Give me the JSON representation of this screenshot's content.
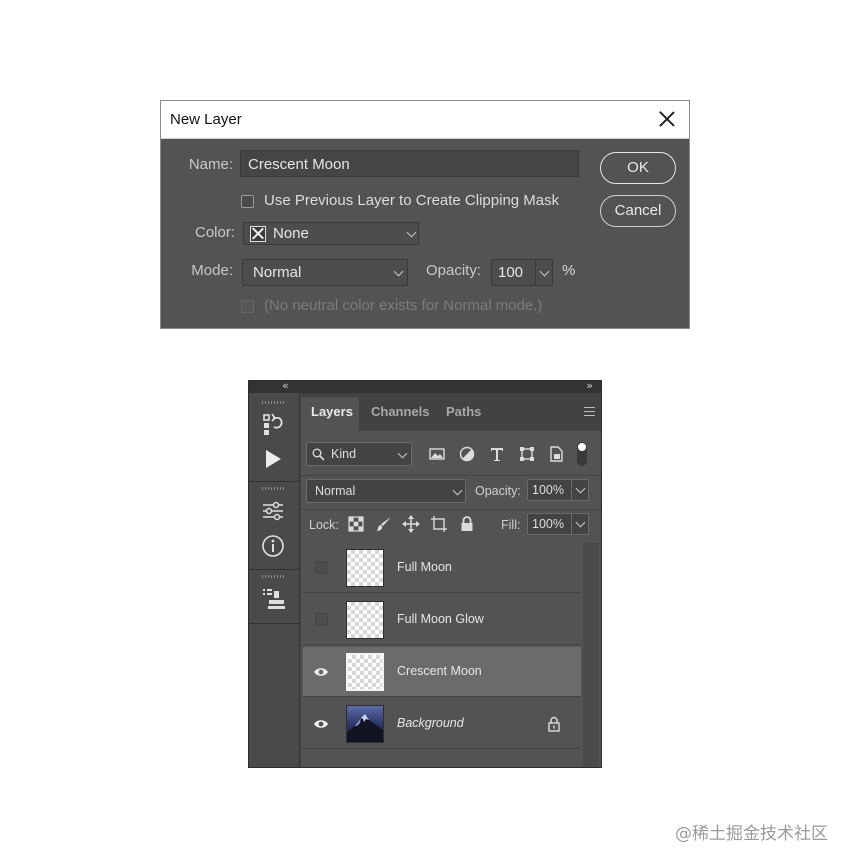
{
  "new_layer_dialog": {
    "title": "New Layer",
    "name_label": "Name:",
    "name_value": "Crescent Moon",
    "clipping_mask_label": "Use Previous Layer to Create Clipping Mask",
    "color_label": "Color:",
    "color_value": "None",
    "mode_label": "Mode:",
    "mode_value": "Normal",
    "opacity_label": "Opacity:",
    "opacity_value": "100",
    "opacity_unit": "%",
    "neutral_color_label": "(No neutral color exists for Normal mode.)",
    "ok_label": "OK",
    "cancel_label": "Cancel"
  },
  "layers_panel": {
    "collapse_left": "«",
    "collapse_right": "»",
    "tabs": [
      {
        "label": "Layers",
        "active": true
      },
      {
        "label": "Channels",
        "active": false
      },
      {
        "label": "Paths",
        "active": false
      }
    ],
    "filter_kind": "Kind",
    "blend_mode": "Normal",
    "opacity_label": "Opacity:",
    "opacity_value": "100%",
    "lock_label": "Lock:",
    "fill_label": "Fill:",
    "fill_value": "100%",
    "layers": [
      {
        "name": "Full Moon",
        "visible": false,
        "selected": false,
        "italic": false,
        "locked": false
      },
      {
        "name": "Full Moon Glow",
        "visible": false,
        "selected": false,
        "italic": false,
        "locked": false
      },
      {
        "name": "Crescent Moon",
        "visible": true,
        "selected": true,
        "italic": false,
        "locked": false
      },
      {
        "name": "Background",
        "visible": true,
        "selected": false,
        "italic": true,
        "locked": true
      }
    ],
    "tool_icons": [
      "history-icon",
      "play-action-icon",
      "adjustments-icon",
      "info-icon",
      "clone-source-icon"
    ]
  },
  "watermark": "@稀土掘金技术社区",
  "colors": {
    "dialog_bg": "#535353",
    "panel_bg": "#535353",
    "selected_row": "#6b6b6b"
  }
}
